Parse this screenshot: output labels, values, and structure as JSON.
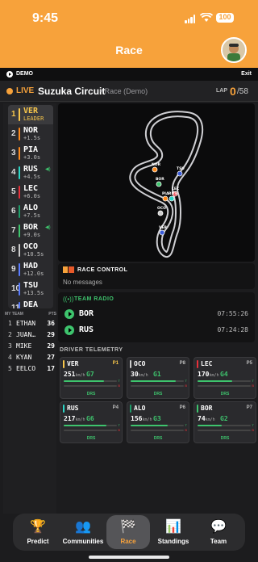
{
  "status_bar": {
    "time": "9:45",
    "battery": "100"
  },
  "header": {
    "title": "Race"
  },
  "demo_bar": {
    "label": "DEMO",
    "exit": "Exit"
  },
  "race_header": {
    "live": "LIVE",
    "circuit": "Suzuka Circuit",
    "subtitle": "• Race (Demo)",
    "lap_label": "LAP",
    "lap": "0",
    "lap_total": "/58"
  },
  "leaderboard": [
    {
      "pos": "1",
      "code": "VER",
      "gap": "LEADER",
      "color": "#f7c64b"
    },
    {
      "pos": "2",
      "code": "NOR",
      "gap": "+1.5s",
      "color": "#ff8a1c"
    },
    {
      "pos": "3",
      "code": "PIA",
      "gap": "+3.0s",
      "color": "#ff8a1c"
    },
    {
      "pos": "4",
      "code": "RUS",
      "gap": "+4.5s",
      "color": "#2bd6c6",
      "radio": true
    },
    {
      "pos": "5",
      "code": "LEC",
      "gap": "+6.0s",
      "color": "#e8303a"
    },
    {
      "pos": "6",
      "code": "ALO",
      "gap": "+7.5s",
      "color": "#1e9e6a"
    },
    {
      "pos": "7",
      "code": "BOR",
      "gap": "+9.0s",
      "color": "#3ec46d",
      "radio": true
    },
    {
      "pos": "8",
      "code": "OCO",
      "gap": "+10.5s",
      "color": "#cccccc"
    },
    {
      "pos": "9",
      "code": "HAD",
      "gap": "+12.0s",
      "color": "#5a7cff"
    },
    {
      "pos": "10",
      "code": "TSU",
      "gap": "+13.5s",
      "color": "#5a7cff"
    },
    {
      "pos": "11",
      "code": "DEA",
      "gap": "",
      "color": "#5a7cff"
    }
  ],
  "my_team": {
    "title": "MY TEAM",
    "pts_label": "PTS",
    "members": [
      {
        "rank": "1",
        "name": "ETHAN",
        "pts": "36"
      },
      {
        "rank": "2",
        "name": "JUAN…",
        "pts": "29"
      },
      {
        "rank": "3",
        "name": "MIKE",
        "pts": "29"
      },
      {
        "rank": "4",
        "name": "KYAN",
        "pts": "27"
      },
      {
        "rank": "5",
        "name": "EELCO",
        "pts": "17"
      }
    ]
  },
  "map_labels": [
    "VER",
    "TSU",
    "LEC",
    "PIA",
    "RUS",
    "NOR",
    "BOR",
    "OCO"
  ],
  "race_control": {
    "title": "RACE CONTROL",
    "message": "No messages"
  },
  "team_radio": {
    "title": "TEAM RADIO",
    "entries": [
      {
        "driver": "BOR",
        "time": "07:55:26"
      },
      {
        "driver": "RUS",
        "time": "07:24:28"
      }
    ]
  },
  "telemetry": {
    "title": "DRIVER TELEMETRY",
    "speed_unit": "km/h",
    "drs_label": "DRS",
    "cards": [
      {
        "code": "VER",
        "pos": "P1",
        "speed": "251",
        "gear": "G7",
        "throttle": 0.75,
        "brake": 0.0,
        "color": "#f7c64b",
        "pos_color": "#f7c64b"
      },
      {
        "code": "OCO",
        "pos": "P8",
        "speed": "30",
        "gear": "G1",
        "throttle": 0.85,
        "brake": 0.0,
        "color": "#cccccc",
        "pos_color": "#bbbbbb"
      },
      {
        "code": "LEC",
        "pos": "P5",
        "speed": "170",
        "gear": "G4",
        "throttle": 0.65,
        "brake": 0.0,
        "color": "#e8303a",
        "pos_color": "#bbbbbb"
      },
      {
        "code": "RUS",
        "pos": "P4",
        "speed": "217",
        "gear": "G6",
        "throttle": 0.8,
        "brake": 0.0,
        "color": "#2bd6c6",
        "pos_color": "#bbbbbb"
      },
      {
        "code": "ALO",
        "pos": "P6",
        "speed": "156",
        "gear": "G3",
        "throttle": 0.7,
        "brake": 0.0,
        "color": "#1e9e6a",
        "pos_color": "#bbbbbb"
      },
      {
        "code": "BOR",
        "pos": "P7",
        "speed": "74",
        "gear": "G2",
        "throttle": 0.45,
        "brake": 0.0,
        "color": "#3ec46d",
        "pos_color": "#bbbbbb"
      }
    ]
  },
  "tabs": [
    {
      "label": "Predict",
      "icon": "trophy-icon",
      "glyph": "🏆"
    },
    {
      "label": "Communities",
      "icon": "people-icon",
      "glyph": "👥"
    },
    {
      "label": "Race",
      "icon": "checkered-flag-icon",
      "glyph": "🏁",
      "active": true
    },
    {
      "label": "Standings",
      "icon": "bar-chart-icon",
      "glyph": "📊"
    },
    {
      "label": "Team",
      "icon": "chat-icon",
      "glyph": "💬"
    }
  ],
  "colors": {
    "accent": "#f7a23b",
    "radio_green": "#3ec46d",
    "background": "#1c1c1e"
  }
}
